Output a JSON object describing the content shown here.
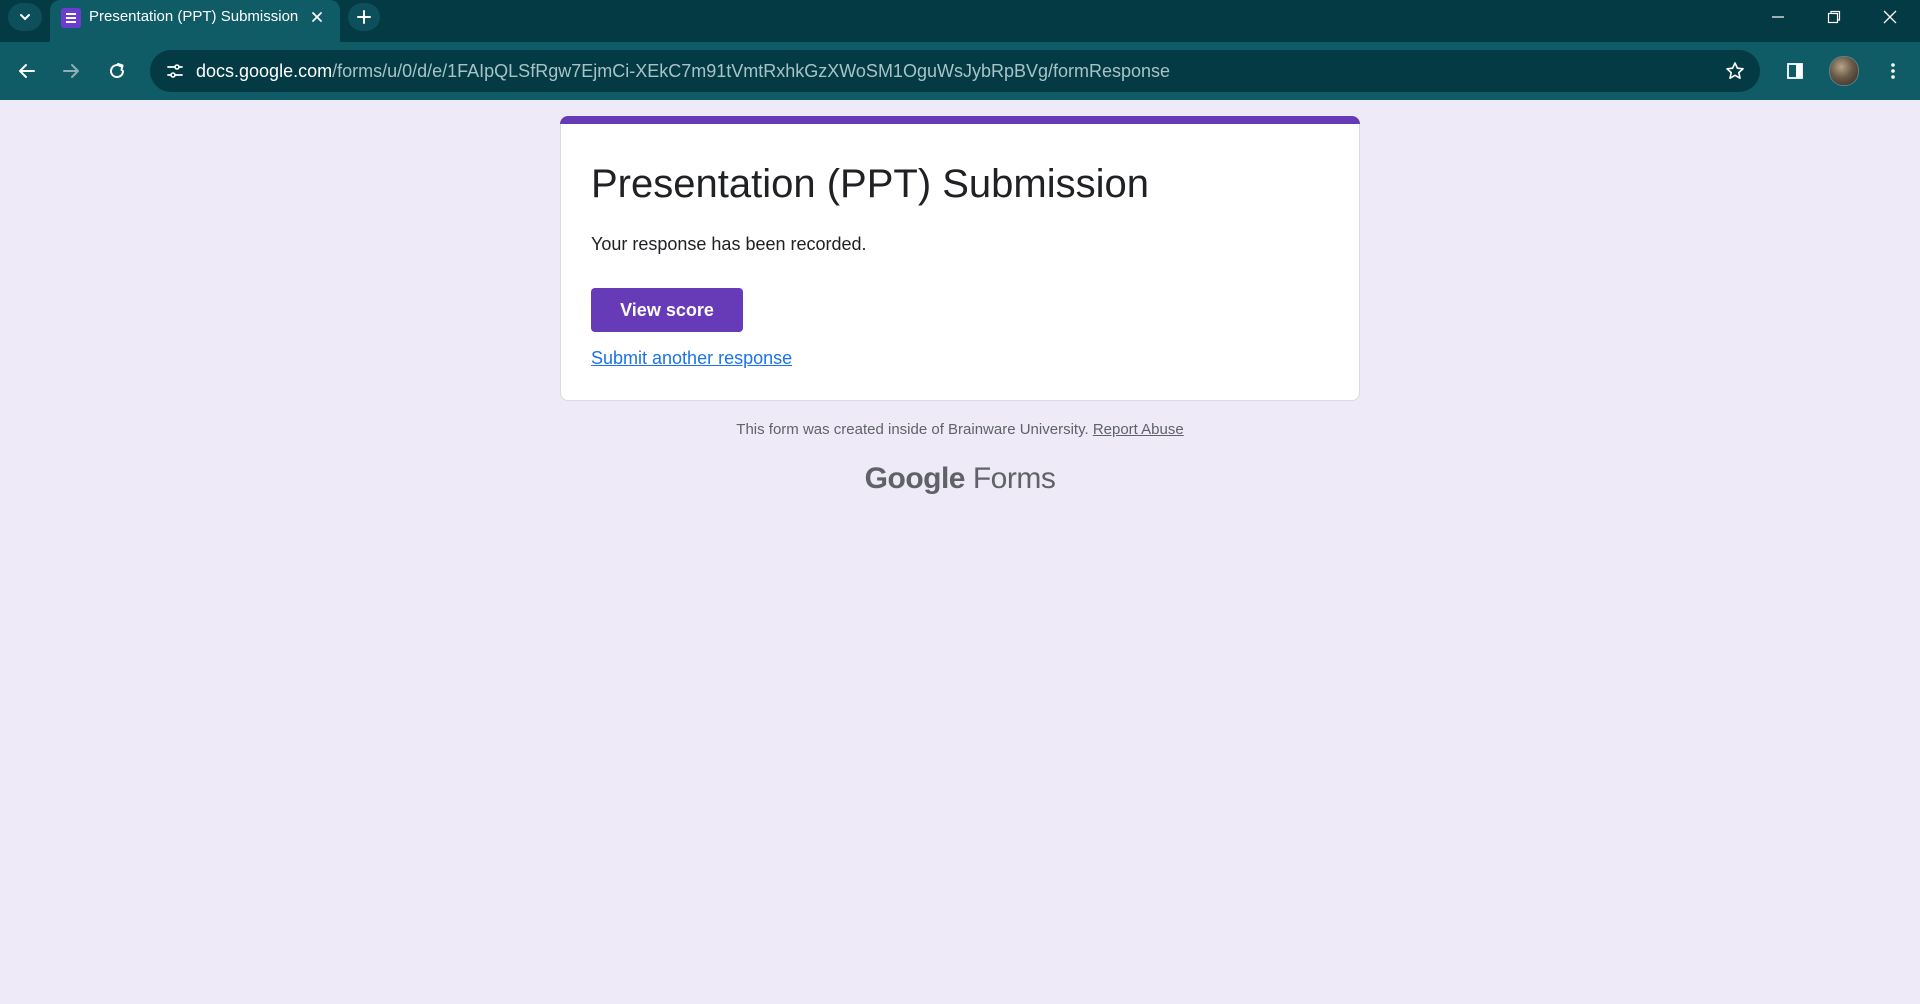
{
  "browser": {
    "tab": {
      "title": "Presentation (PPT) Submission",
      "favicon": "google-forms-icon"
    },
    "url": {
      "host": "docs.google.com",
      "path": "/forms/u/0/d/e/1FAIpQLSfRgw7EjmCi-XEkC7m91tVmtRxhkGzXWoSM1OguWsJybRpBVg/formResponse"
    },
    "colors": {
      "tabbar": "#033a44",
      "toolbar": "#0f5b66",
      "omnibox": "#033a44"
    }
  },
  "form": {
    "title": "Presentation (PPT) Submission",
    "confirmation": "Your response has been recorded.",
    "view_score_label": "View score",
    "submit_another_label": "Submit another response",
    "accent_color": "#673ab7",
    "background_color": "#efeaf8"
  },
  "footer": {
    "note": "This form was created inside of Brainware University.",
    "report_abuse": "Report Abuse",
    "logo_brand": "Google",
    "logo_product": "Forms"
  }
}
